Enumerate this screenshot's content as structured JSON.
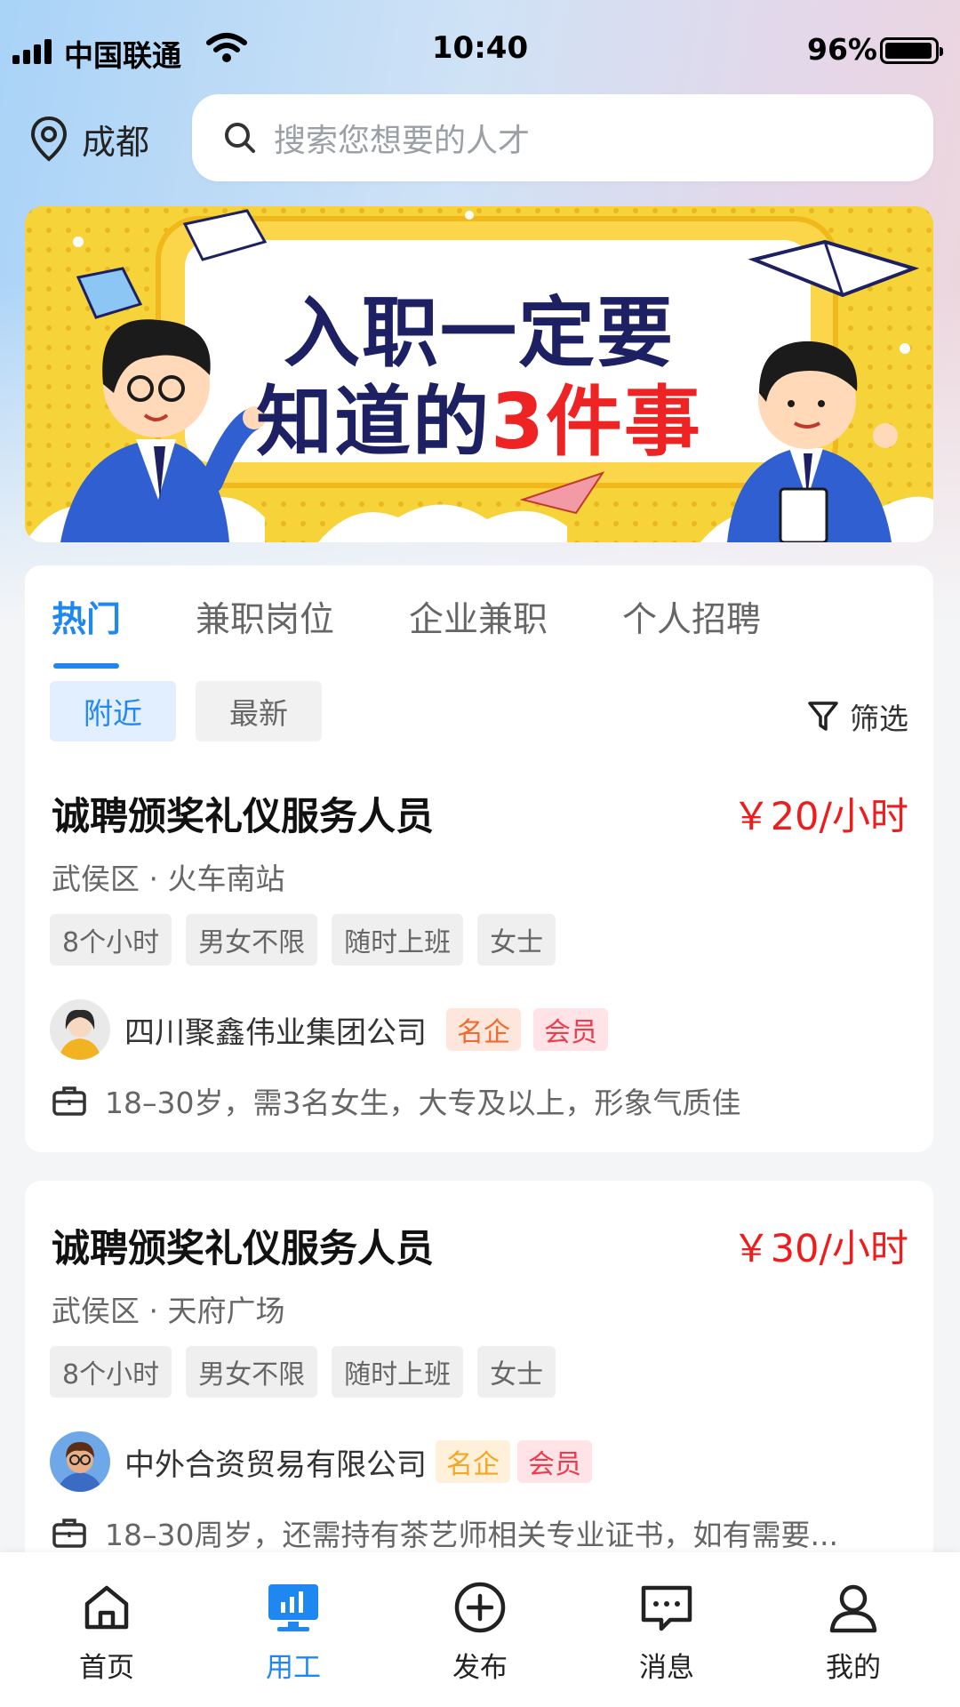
{
  "status_bar": {
    "carrier": "中国联通",
    "time": "10:40",
    "battery": "96%"
  },
  "header": {
    "city": "成都",
    "search_placeholder": "搜索您想要的人才"
  },
  "banner": {
    "line1": "入职一定要",
    "line2_prefix": "知道的",
    "line2_highlight": "3件事"
  },
  "tabs": [
    {
      "label": "热门",
      "active": true
    },
    {
      "label": "兼职岗位",
      "active": false
    },
    {
      "label": "企业兼职",
      "active": false
    },
    {
      "label": "个人招聘",
      "active": false
    }
  ],
  "chips": [
    {
      "label": "附近",
      "active": true
    },
    {
      "label": "最新",
      "active": false
    }
  ],
  "filter_label": "筛选",
  "jobs": [
    {
      "title": "诚聘颁奖礼仪服务人员",
      "pay": "￥20/小时",
      "location": "武侯区 · 火车南站",
      "tags": [
        "8个小时",
        "男女不限",
        "随时上班",
        "女士"
      ],
      "company": "四川聚鑫伟业集团公司",
      "badges": [
        "名企",
        "会员"
      ],
      "description": "18–30岁，需3名女生，大专及以上，形象气质佳"
    },
    {
      "title": "诚聘颁奖礼仪服务人员",
      "pay": "￥30/小时",
      "location": "武侯区 · 天府广场",
      "tags": [
        "8个小时",
        "男女不限",
        "随时上班",
        "女士"
      ],
      "company": "中外合资贸易有限公司",
      "badges": [
        "名企",
        "会员"
      ],
      "description": "18–30周岁，还需持有茶艺师相关专业证书，如有需要..."
    }
  ],
  "nav": [
    {
      "label": "首页",
      "icon": "home-icon",
      "active": false
    },
    {
      "label": "用工",
      "icon": "dashboard-icon",
      "active": true
    },
    {
      "label": "发布",
      "icon": "plus-circle-icon",
      "active": false
    },
    {
      "label": "消息",
      "icon": "message-icon",
      "active": false
    },
    {
      "label": "我的",
      "icon": "user-icon",
      "active": false
    }
  ],
  "colors": {
    "accent": "#1e88f0",
    "price": "#ee1c1c",
    "banner_yellow": "#f7d33a",
    "banner_navy": "#1d2063"
  }
}
